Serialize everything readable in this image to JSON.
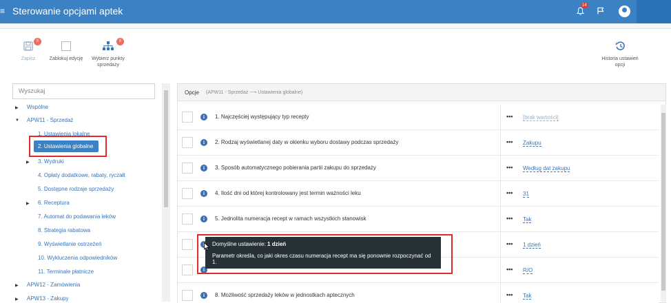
{
  "header": {
    "title": "Sterowanie opcjami aptek",
    "notification_count": "14"
  },
  "toolbar": {
    "save": {
      "label": "Zapisz",
      "badge": "0"
    },
    "lock": {
      "label": "Zablokuj edycję"
    },
    "points": {
      "label_line1": "Wybierz punkty",
      "label_line2": "sprzedaży",
      "badge": "0"
    },
    "history": {
      "label_line1": "Historia ustawień",
      "label_line2": "opcji"
    }
  },
  "search": {
    "placeholder": "Wyszukaj"
  },
  "tree": {
    "items": [
      {
        "label": "Wspólne"
      },
      {
        "label": "APW11 - Sprzedaż"
      },
      {
        "label": "1. Ustawienia lokalne"
      },
      {
        "label": "2. Ustawienia globalne"
      },
      {
        "label": "3. Wydruki"
      },
      {
        "label": "4. Opłaty dodatkowe, rabaty, ryczałt"
      },
      {
        "label": "5. Dostępne rodzaje sprzedaży"
      },
      {
        "label": "6. Receptura"
      },
      {
        "label": "7. Automat do podawania leków"
      },
      {
        "label": "8. Strategia rabatowa"
      },
      {
        "label": "9. Wyświetlanie ostrzeżeń"
      },
      {
        "label": "10. Wykluczenia odpowiedników"
      },
      {
        "label": "11. Terminale płatnicze"
      },
      {
        "label": "APW12 - Zamówienia"
      },
      {
        "label": "APW13 - Zakupy"
      }
    ]
  },
  "panel": {
    "title": "Opcje",
    "breadcrumb": "(APW11 - Sprzedaż ⟶ Ustawienia globalne)",
    "rows": [
      {
        "text": "1. Najczęściej występujący typ recepty",
        "value": "[brak wartości]"
      },
      {
        "text": "2. Rodzaj wyświetlanej daty w okienku wyboru dostawy podczas sprzedaży",
        "value": "Zakupu"
      },
      {
        "text": "3. Sposób automatycznego pobierania partii zakupu do sprzedaży",
        "value": "Według dat zakupu"
      },
      {
        "text": "4. Ilość dni od której kontrolowany jest termin ważności leku",
        "value": "31"
      },
      {
        "text": "5. Jednolita numeracja recept w ramach wszystkich stanowisk",
        "value": "Tak"
      },
      {
        "text": "",
        "value": "1 dzień"
      },
      {
        "text": "",
        "value": "R/O"
      },
      {
        "text": "8. Możliwość sprzedaży leków w jednostkach aptecznych",
        "value": "Tak"
      }
    ]
  },
  "tooltip": {
    "default_label": "Domyślne ustawienie:",
    "default_value": "1 dzień",
    "description": "Parametr określa, co jaki okres czasu numeracja recept ma się ponownie rozpoczynać od 1."
  },
  "colors": {
    "header": "#3b82c4",
    "accent": "#3a74b5",
    "highlight_border": "#e02a2a",
    "tooltip_bg": "#263238",
    "badge": "#ef6c5e"
  }
}
